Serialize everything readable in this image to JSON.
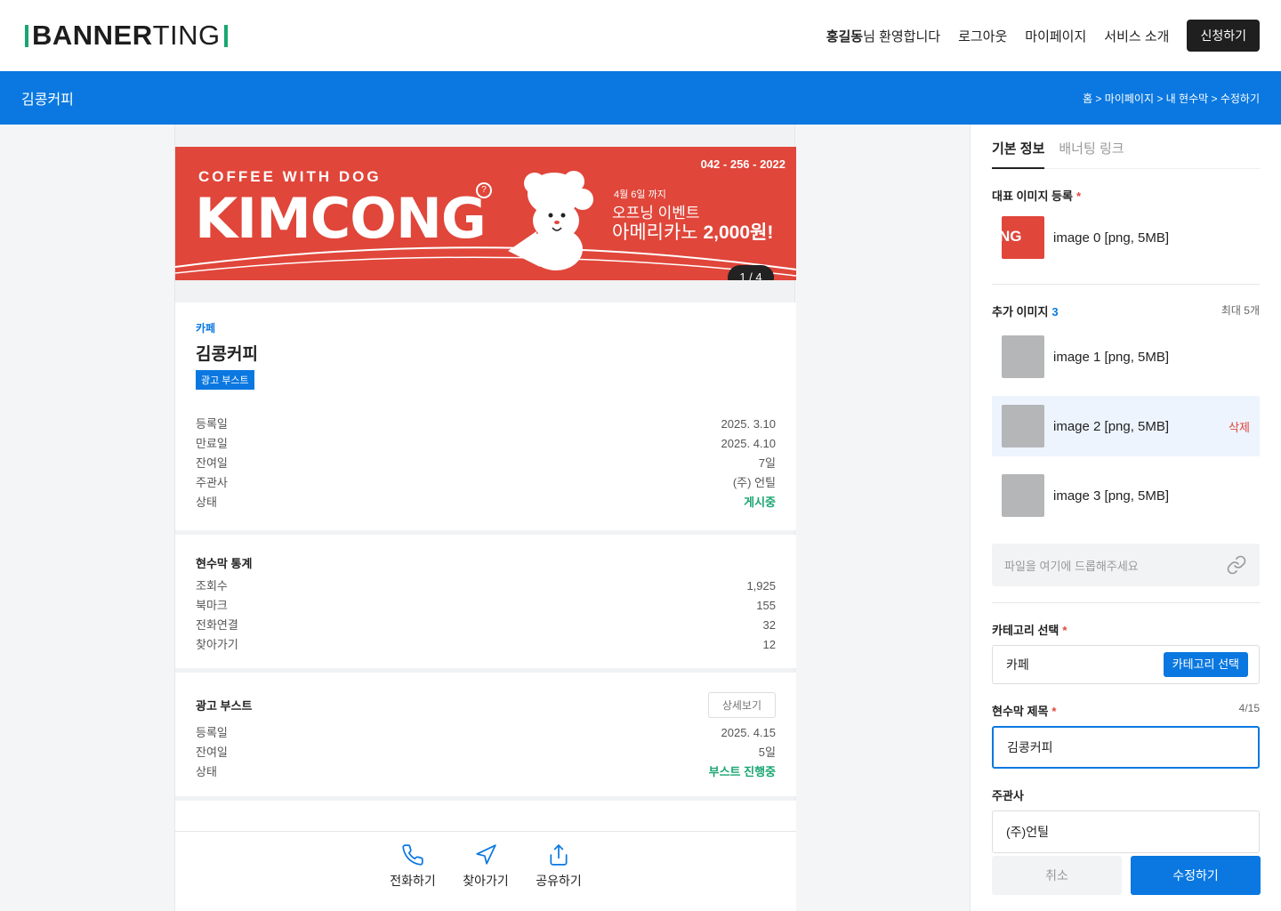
{
  "header": {
    "logo_bold": "BANNER",
    "logo_light": "TING",
    "welcome_name": "홍길동",
    "welcome_suffix": "님 환영합니다",
    "nav": [
      "로그아웃",
      "마이페이지",
      "서비스 소개"
    ],
    "apply": "신청하기"
  },
  "page": {
    "title": "김콩커피",
    "breadcrumb": "홈 > 마이페이지 > 내 현수막 > 수정하기"
  },
  "banner": {
    "tagline": "COFFEE WITH DOG",
    "brand": "KIMCONG",
    "phone": "042 - 256 - 2022",
    "event_date": "4월 6일 까지",
    "event_title": "오프닝 이벤트",
    "event_item": "아메리카노",
    "event_price": "2,000원!",
    "pager": "1 / 4"
  },
  "info": {
    "category": "카페",
    "name": "김콩커피",
    "tag": "광고 부스트",
    "rows": [
      {
        "k": "등록일",
        "v": "2025. 3.10"
      },
      {
        "k": "만료일",
        "v": "2025. 4.10"
      },
      {
        "k": "잔여일",
        "v": "7일"
      },
      {
        "k": "주관사",
        "v": "(주) 언틸"
      },
      {
        "k": "상태",
        "v": "게시중"
      }
    ]
  },
  "stats": {
    "title": "현수막 통계",
    "rows": [
      {
        "k": "조회수",
        "v": "1,925"
      },
      {
        "k": "북마크",
        "v": "155"
      },
      {
        "k": "전화연결",
        "v": "32"
      },
      {
        "k": "찾아가기",
        "v": "12"
      }
    ]
  },
  "boost": {
    "title": "광고 부스트",
    "detail": "상세보기",
    "rows": [
      {
        "k": "등록일",
        "v": "2025. 4.15"
      },
      {
        "k": "잔여일",
        "v": "5일"
      },
      {
        "k": "상태",
        "v": "부스트 진행중"
      }
    ]
  },
  "actions": {
    "call": "전화하기",
    "directions": "찾아가기",
    "share": "공유하기"
  },
  "panel": {
    "tabs": [
      "기본 정보",
      "배너팅 링크"
    ],
    "main_image_label": "대표 이미지 등록",
    "main_image": "image 0 [png, 5MB]",
    "main_thumb_text": "NG",
    "extra_label": "추가 이미지",
    "extra_count": "3",
    "extra_max": "최대 5개",
    "extra_images": [
      "image 1 [png, 5MB]",
      "image 2 [png, 5MB]",
      "image 3 [png, 5MB]"
    ],
    "delete": "삭제",
    "drop_placeholder": "파일을 여기에 드롭해주세요",
    "category_label": "카테고리 선택",
    "category_value": "카페",
    "category_button": "카테고리 선택",
    "title_label": "현수막 제목",
    "title_counter": "4/15",
    "title_value": "김콩커피",
    "host_label": "주관사",
    "host_value": "(주)언틸",
    "cancel": "취소",
    "save": "수정하기"
  },
  "colors": {
    "primary": "#0a78e0",
    "banner_red": "#e0463a",
    "status_green": "#1aa672",
    "required": "#e0463a"
  }
}
